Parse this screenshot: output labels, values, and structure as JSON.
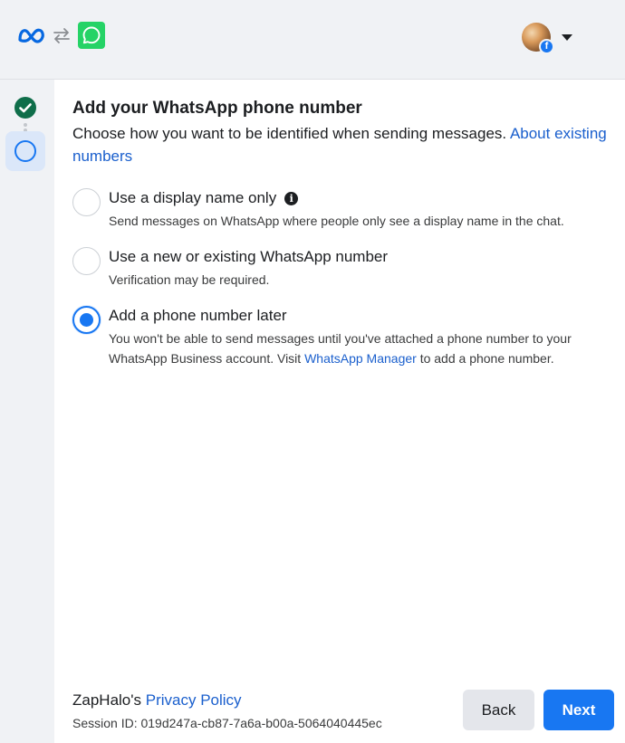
{
  "header": {
    "logos": [
      "meta-logo-icon",
      "swap-arrows-icon",
      "whatsapp-logo-icon"
    ],
    "profile_menu": "avatar-with-facebook-badge"
  },
  "stepper": {
    "steps": [
      "completed",
      "current"
    ]
  },
  "main": {
    "title": "Add your WhatsApp phone number",
    "subtitle_text": "Choose how you want to be identified when sending messages. ",
    "subtitle_link": "About existing numbers",
    "options": [
      {
        "label": "Use a display name only",
        "description": "Send messages on WhatsApp where people only see a display name in the chat.",
        "selected": false
      },
      {
        "label": "Use a new or existing WhatsApp number",
        "description": "Verification may be required.",
        "selected": false
      },
      {
        "label": "Add a phone number later",
        "description_part1": "You won't be able to send messages until you've attached a phone number to your WhatsApp Business account. Visit ",
        "description_link": "WhatsApp Manager",
        "description_part2": " to add a phone number.",
        "selected": true
      }
    ]
  },
  "footer": {
    "company": "ZapHalo's",
    "privacy_link": "Privacy Policy",
    "session_label": "Session ID: 019d247a-cb87-7a6a-b00a-5064040445ec",
    "back_label": "Back",
    "next_label": "Next"
  },
  "colors": {
    "accent": "#1877f2",
    "link": "#1a5fcd",
    "success": "#0f6e4a",
    "whatsapp": "#25d366",
    "sidebar_bg": "#f0f2f5"
  }
}
